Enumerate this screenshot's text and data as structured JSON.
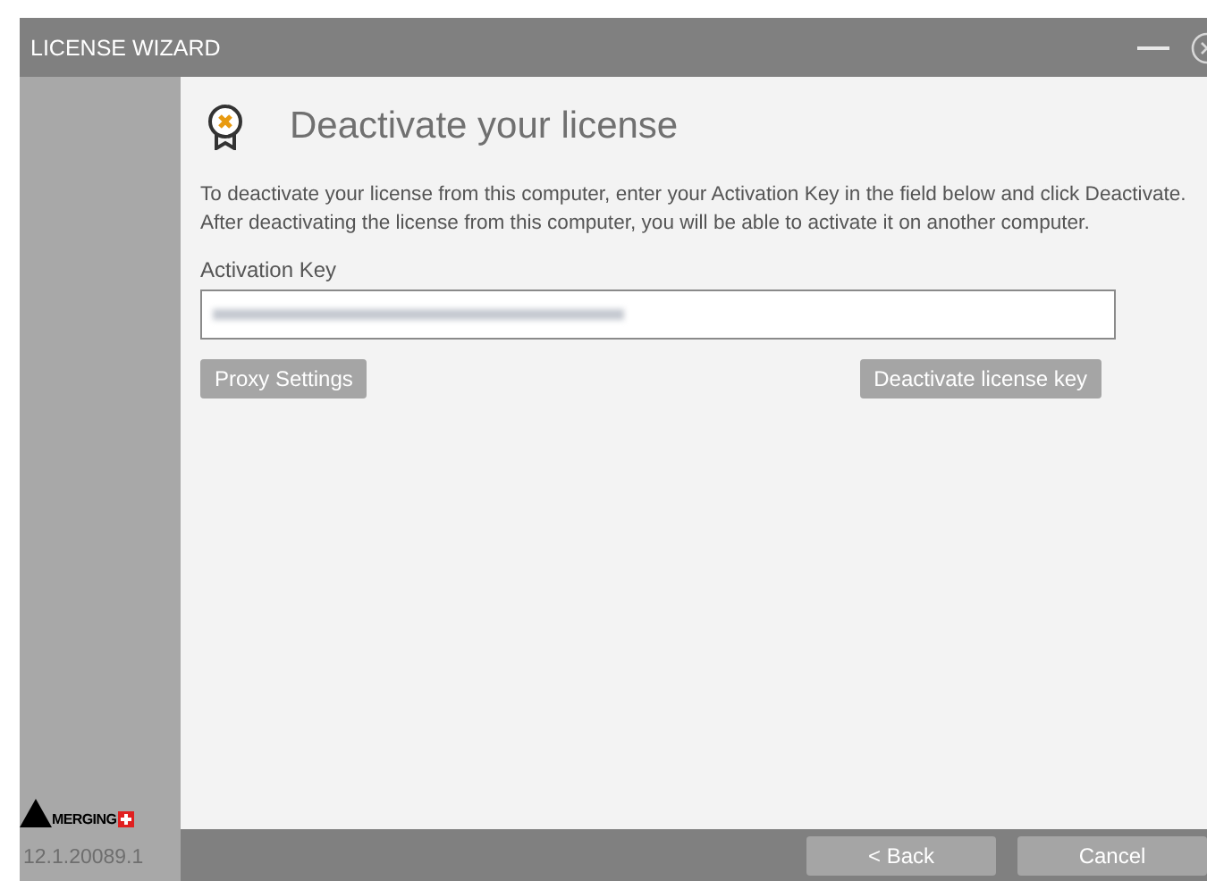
{
  "window": {
    "title": "LICENSE WIZARD"
  },
  "heading": "Deactivate your license",
  "description": "To deactivate your license from this computer, enter your Activation Key in the field below and click Deactivate. After deactivating the license from this computer, you will be able to activate it on another computer.",
  "activation_key": {
    "label": "Activation Key"
  },
  "buttons": [
    "Proxy Settings",
    "Deactivate license key"
  ],
  "sidebar": {
    "logo_text": "MERGING",
    "version": "12.1.20089.1"
  },
  "footer_buttons": [
    "< Back",
    "Cancel"
  ]
}
